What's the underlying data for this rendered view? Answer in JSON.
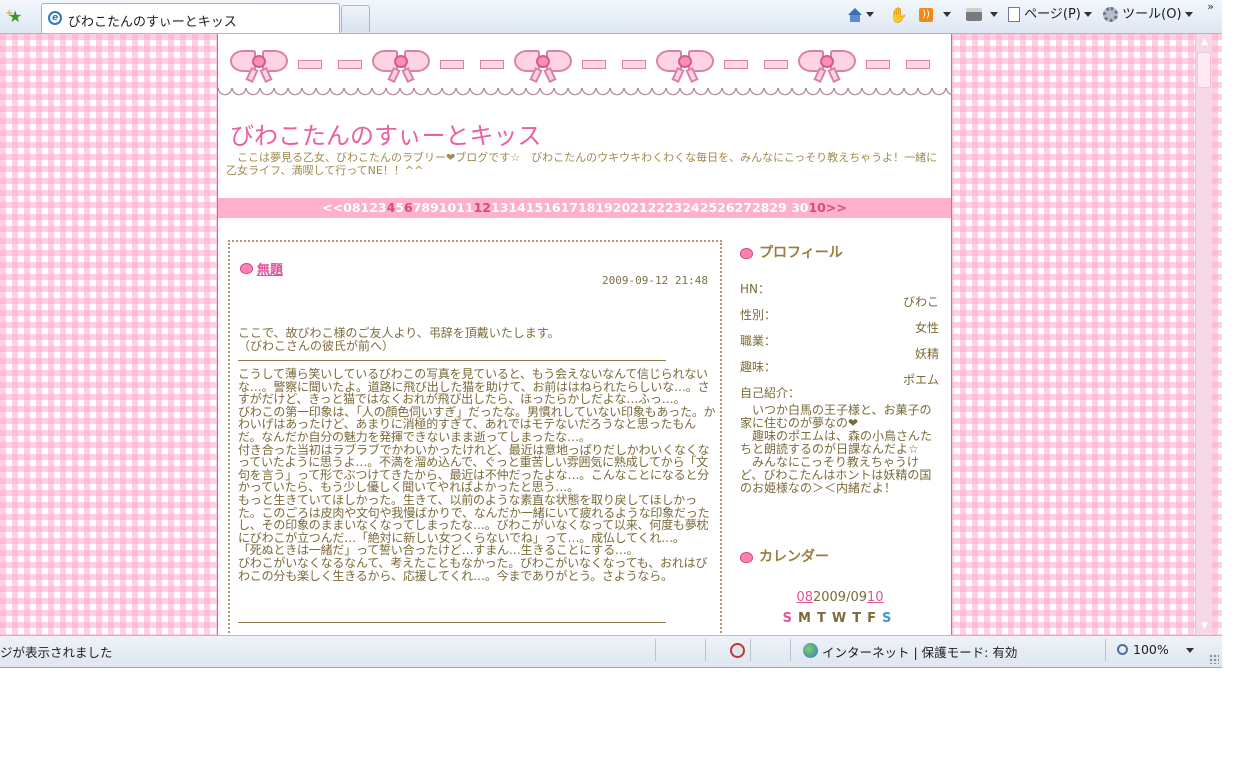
{
  "browser": {
    "tab_title": "びわこたんのすぃーとキッス",
    "commands": {
      "page_label": "ページ(P)",
      "tools_label": "ツール(O)"
    },
    "chevron": "»"
  },
  "blog": {
    "title": "びわこたんのすぃーとキッス",
    "description": "　ここは夢見る乙女、びわこたんのラブリー❤ブログです☆　びわこたんのウキウキわくわくな毎日を、みんなにこっそり教えちゃうよ！一緒に乙女ライフ、満喫して行ってNE！！^^",
    "nav": {
      "prev": "<<08",
      "d1": "123",
      "d4": "4",
      "d5": "5",
      "d6": "6",
      "d7": "7891011",
      "d12": "12",
      "d13": "1314151617181920212223242526272829 30",
      "next": "10>>"
    }
  },
  "entry": {
    "title": "無題",
    "date": "2009-09-12 21:48",
    "intro": "ここで、故びわこ様のご友人より、弔辞を頂戴いたします。\n（びわこさんの彼氏が前へ）",
    "body": "こうして薄ら笑いしているびわこの写真を見ていると、もう会えないなんて信じられないな…。警察に聞いたよ。道路に飛び出した猫を助けて、お前ははねられたらしいな…。さすがだけど、きっと猫ではなくおれが飛び出したら、ほったらかしだよな…ふっ…。\nびわこの第一印象は、「人の顔色伺いすぎ」だったな。男慣れしていない印象もあった。かわいげはあったけど、あまりに消極的すぎて、あれではモテないだろうなと思ったもんだ。なんだか自分の魅力を発揮できないまま逝ってしまったな…。\n付き合った当初はラブラブでかわいかったけれど、最近は意地っぱりだしかわいくなくなっていたように思うよ…。不満を溜め込んで、ぐっと重苦しい雰囲気に熟成してから「文句を言う」って形でぶつけてきたから、最近は不仲だったよな…。こんなことになると分かっていたら、もう少し優しく聞いてやればよかったと思う…。\nもっと生きていてほしかった。生きて、以前のような素直な状態を取り戻してほしかった。このごろは皮肉や文句や我慢ばかりで、なんだか一緒にいて疲れるような印象だったし、その印象のままいなくなってしまったな…。びわこがいなくなって以来、何度も夢枕にびわこが立つんだ…「絶対に新しい女つくらないでね」って…。成仏してくれ…。\n「死ぬときは一緒だ」って誓い合ったけど…すまん…生きることにする…。\nびわこがいなくなるなんて、考えたこともなかった。びわこがいなくなっても、おれはびわこの分も楽しく生きるから、応援してくれ…。今までありがとう。さようなら。"
  },
  "sidebar": {
    "profile_heading": "プロフィール",
    "profile": {
      "hn_label": "HN：",
      "hn_value": "びわこ",
      "gender_label": "性別：",
      "gender_value": "女性",
      "job_label": "職業：",
      "job_value": "妖精",
      "hobby_label": "趣味：",
      "hobby_value": "ポエム",
      "intro_label": "自己紹介：",
      "intro_text": "　いつか白馬の王子様と、お菓子の家に住むのが夢なの❤\n　趣味のポエムは、森の小鳥さんたちと朗読するのが日課なんだよ☆\n　みんなにこっそり教えちゃうけど、びわこたんはホントは妖精の国のお姫様なの＞＜内緒だよ！"
    },
    "calendar_heading": "カレンダー",
    "calendar": {
      "prev": "08",
      "current": "2009/09",
      "next": "10",
      "weekdays": [
        "S",
        "M",
        "T",
        "W",
        "T",
        "F",
        "S"
      ]
    }
  },
  "status": {
    "text": "ジが表示されました",
    "zone": "インターネット | 保護モード: 有効",
    "zoom": "100%"
  },
  "colors": {
    "accent_pink": "#ea5f9f",
    "nav_bar": "#ffb0cb",
    "text_brown": "#7d6a36"
  }
}
